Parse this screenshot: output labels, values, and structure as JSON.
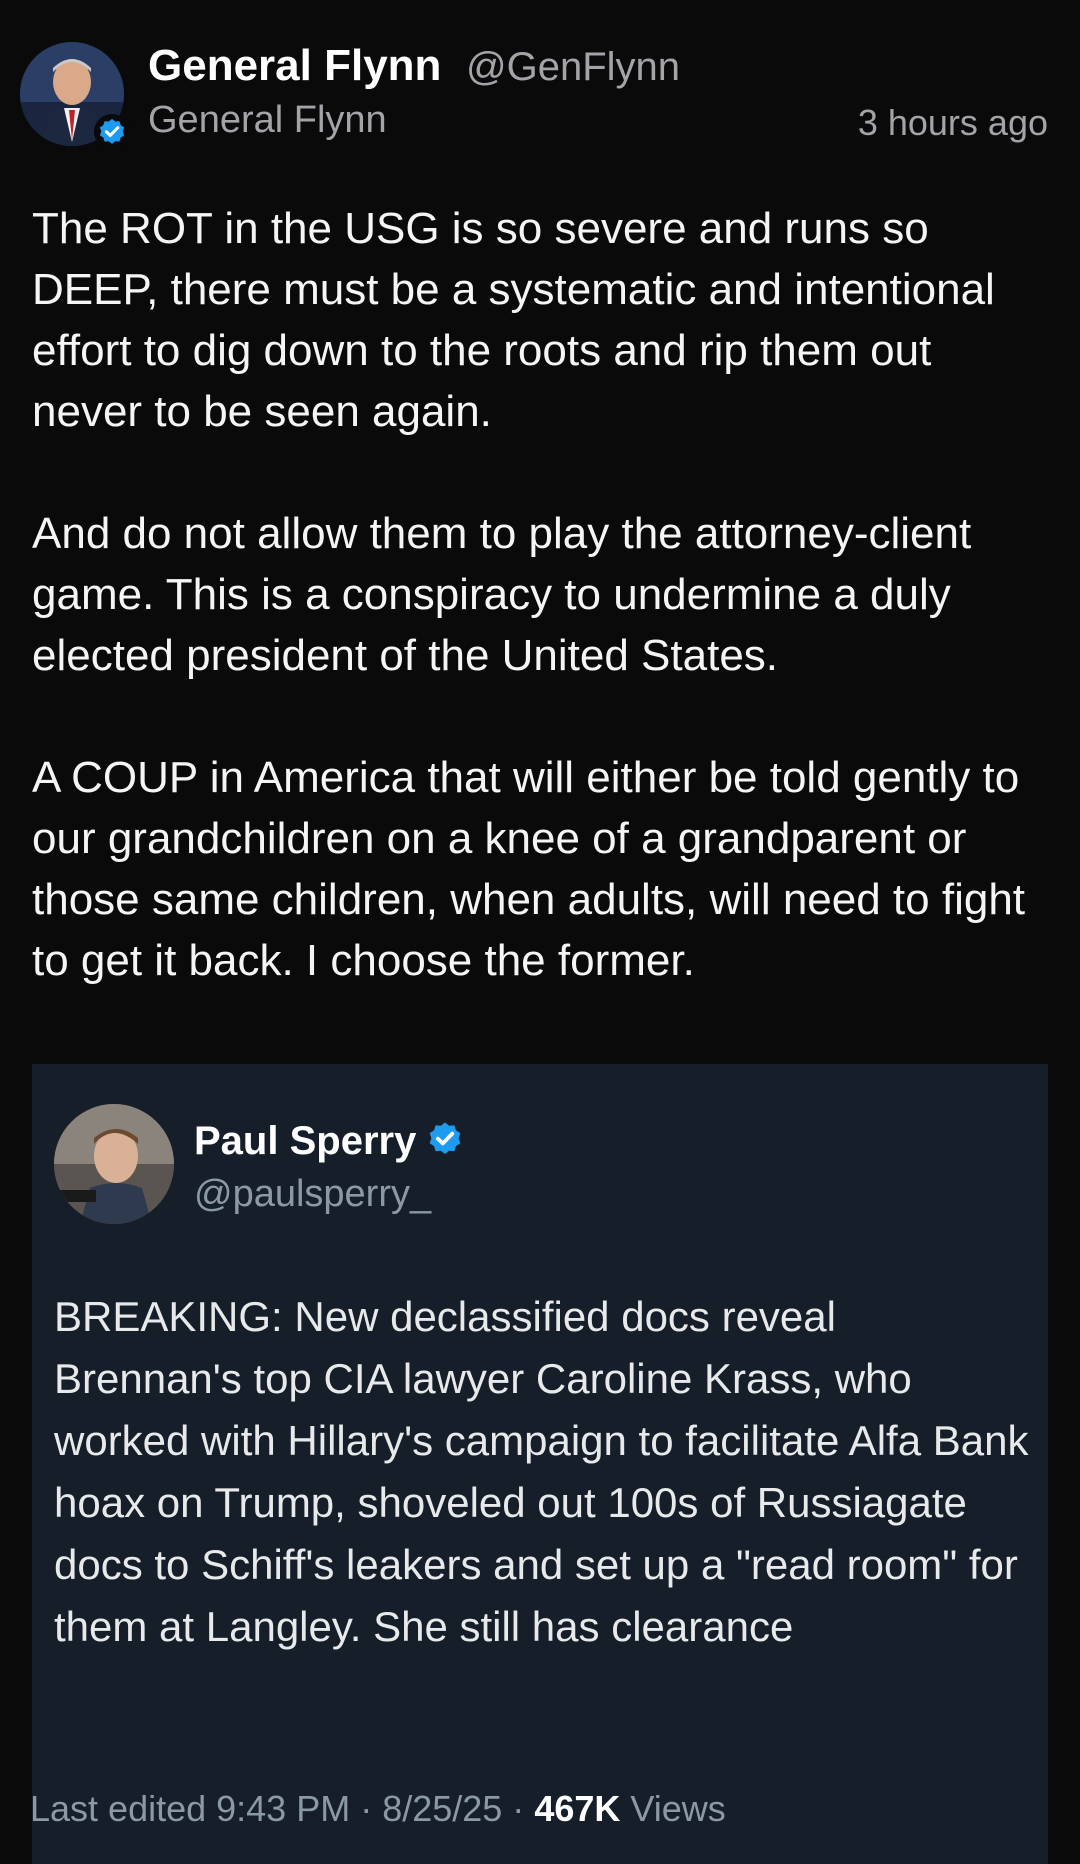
{
  "post": {
    "author": {
      "display_name": "General Flynn",
      "handle": "@GenFlynn",
      "sub_name": "General Flynn",
      "verified": true
    },
    "timestamp": "3 hours ago",
    "paragraphs": [
      "The ROT in the USG is so severe and runs so DEEP, there must be a systematic and intentional effort to dig down to the roots and rip them out never to be seen again.",
      "And do not allow them to play the attorney-client game. This is a conspiracy to undermine a duly elected president of the United States.",
      "A COUP in America that will either be told gently to our grandchildren on a knee of a grandparent or those same children, when adults, will need to fight to get it back. I choose the former."
    ]
  },
  "quoted_post": {
    "author": {
      "display_name": "Paul Sperry",
      "handle": "@paulsperry_",
      "verified": true
    },
    "text": "BREAKING: New declassified docs reveal Brennan's top CIA lawyer Caroline Krass, who worked with Hillary's campaign to facilitate Alfa Bank hoax on Trump, shoveled out 100s of Russiagate docs to Schiff's leakers and set up a \"read room\" for them at Langley. She still has clearance",
    "footer": {
      "prefix": "Last edited 9:43 PM · 8/25/25 · ",
      "views_count": "467K",
      "views_label": " Views"
    }
  },
  "icons": {
    "verified": "verified-badge-icon"
  },
  "colors": {
    "background": "#0a0a0b",
    "card_background": "#161e2a",
    "verified_blue": "#1d9bf0",
    "secondary_text": "#a3a3a8"
  }
}
